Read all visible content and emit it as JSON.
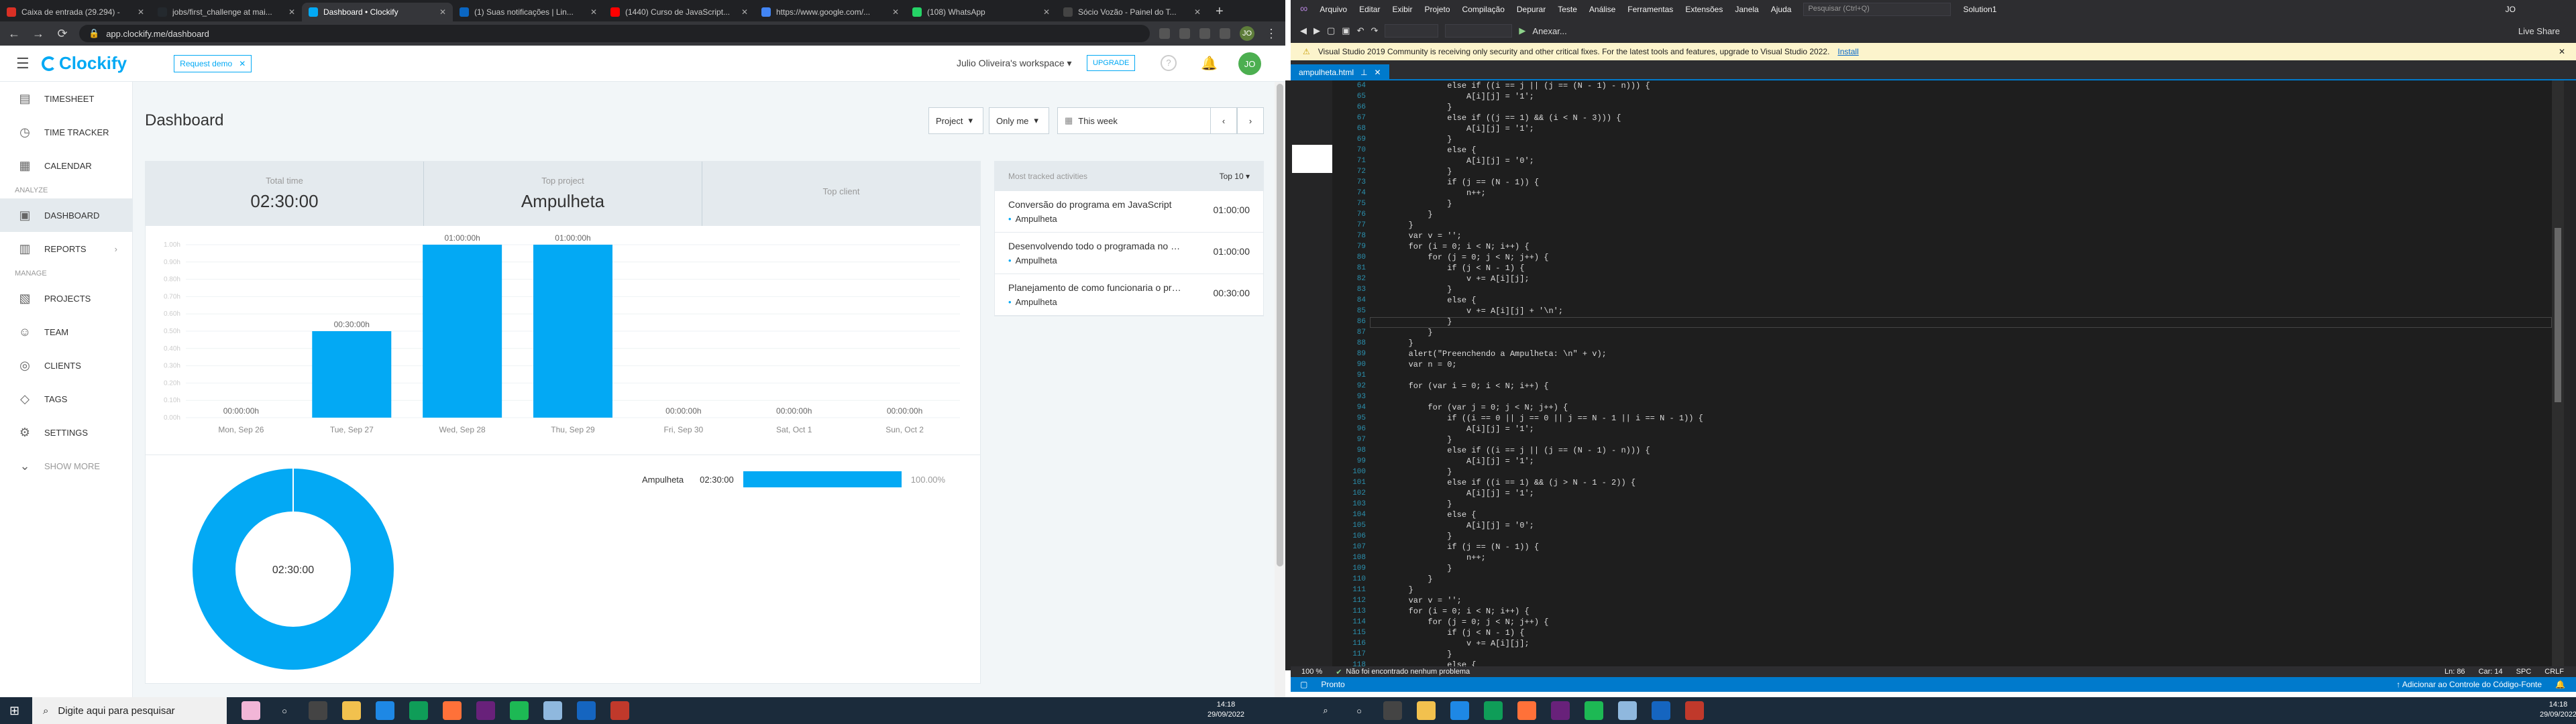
{
  "browser": {
    "tabs": [
      {
        "title": "Caixa de entrada (29.294) -",
        "color": "#d93025"
      },
      {
        "title": "jobs/first_challenge at mai...",
        "color": "#24292e"
      },
      {
        "title": "Dashboard • Clockify",
        "color": "#03a9f4",
        "active": true
      },
      {
        "title": "(1) Suas notificações | Lin...",
        "color": "#0a66c2"
      },
      {
        "title": "(1440) Curso de JavaScript...",
        "color": "#ff0000"
      },
      {
        "title": "https://www.google.com/...",
        "color": "#4285f4"
      },
      {
        "title": "(108) WhatsApp",
        "color": "#25d366"
      },
      {
        "title": "Sócio Vozão - Painel do T...",
        "color": "#444444"
      }
    ],
    "new_tab": "+",
    "url": "app.clockify.me/dashboard",
    "profile": "JO"
  },
  "clockify": {
    "logo": "Clockify",
    "request_demo": "Request demo",
    "workspace": "Julio Oliveira's workspace",
    "upgrade": "UPGRADE",
    "user_initials": "JO",
    "sidebar": {
      "timesheet": "TIMESHEET",
      "time_tracker": "TIME TRACKER",
      "calendar": "CALENDAR",
      "section_analyze": "ANALYZE",
      "dashboard": "DASHBOARD",
      "reports": "REPORTS",
      "section_manage": "MANAGE",
      "projects": "PROJECTS",
      "team": "TEAM",
      "clients": "CLIENTS",
      "tags": "TAGS",
      "settings": "SETTINGS",
      "show_more": "SHOW MORE"
    },
    "title": "Dashboard",
    "filters": {
      "group": "Project",
      "scope": "Only me",
      "range": "This week"
    },
    "summary": {
      "total_time_label": "Total time",
      "total_time": "02:30:00",
      "top_project_label": "Top project",
      "top_project": "Ampulheta",
      "top_client_label": "Top client",
      "top_client": ""
    },
    "activities": {
      "header": "Most tracked activities",
      "top": "Top 10",
      "items": [
        {
          "desc": "Conversão do programa em JavaScript",
          "project": "Ampulheta",
          "time": "01:00:00"
        },
        {
          "desc": "Desenvolvendo todo o programada no Node",
          "project": "Ampulheta",
          "time": "01:00:00"
        },
        {
          "desc": "Planejamento de como funcionaria o programa",
          "project": "Ampulheta",
          "time": "00:30:00"
        }
      ]
    },
    "pie": {
      "center": "02:30:00",
      "legend_project": "Ampulheta",
      "legend_time": "02:30:00",
      "legend_percent": "100.00%",
      "fraction": 1.0
    },
    "colors": {
      "accent": "#03a9f4"
    }
  },
  "chart_data": {
    "type": "bar",
    "categories": [
      "Mon, Sep 26",
      "Tue, Sep 27",
      "Wed, Sep 28",
      "Thu, Sep 29",
      "Fri, Sep 30",
      "Sat, Oct 1",
      "Sun, Oct 2"
    ],
    "values": [
      0,
      0.5,
      1.0,
      1.0,
      0,
      0,
      0
    ],
    "data_labels": [
      "00:00:00h",
      "00:30:00h",
      "01:00:00h",
      "01:00:00h",
      "00:00:00h",
      "00:00:00h",
      "00:00:00h"
    ],
    "y_ticks": [
      "0.00h",
      "0.10h",
      "0.20h",
      "0.30h",
      "0.40h",
      "0.50h",
      "0.60h",
      "0.70h",
      "0.80h",
      "0.90h",
      "1.00h"
    ],
    "ylim": [
      0,
      1.0
    ],
    "color": "#03a9f4"
  },
  "vs": {
    "menu": [
      "Arquivo",
      "Editar",
      "Exibir",
      "Projeto",
      "Compilação",
      "Depurar",
      "Teste",
      "Análise",
      "Ferramentas",
      "Extensões",
      "Janela",
      "Ajuda"
    ],
    "search_placeholder": "Pesquisar (Ctrl+Q)",
    "solution": "Solution1",
    "user": "JO",
    "run": "Anexar...",
    "live_share": "Live Share",
    "info_text": "Visual Studio 2019 Community is receiving only security and other critical fixes. For the latest tools and features, upgrade to Visual Studio 2022.",
    "info_link": "Install",
    "file_tab": "ampulheta.html",
    "zoom": "100 %",
    "issues": "Não foi encontrado nenhum problema",
    "cursor": "Ln: 86",
    "col": "Car: 14",
    "spc": "SPC",
    "crlf": "CRLF",
    "status_ready": "Pronto",
    "status_git": "Adicionar ao Controle do Código-Fonte",
    "code_top": [
      {
        "n": "64",
        "t": "                else if ((i == j || (j == (N - 1) - n))) {"
      },
      {
        "n": "65",
        "t": "                    A[i][j] = '1';"
      },
      {
        "n": "66",
        "t": "                }"
      },
      {
        "n": "67",
        "t": "                else if ((j == 1) && (i < N - 3))) {"
      },
      {
        "n": "68",
        "t": "                    A[i][j] = '1';"
      },
      {
        "n": "69",
        "t": "                }"
      },
      {
        "n": "70",
        "t": "                else {"
      },
      {
        "n": "71",
        "t": "                    A[i][j] = '0';"
      },
      {
        "n": "72",
        "t": "                }"
      },
      {
        "n": "73",
        "t": "                if (j == (N - 1)) {"
      },
      {
        "n": "74",
        "t": "                    n++;"
      },
      {
        "n": "75",
        "t": "                }"
      },
      {
        "n": "76",
        "t": "            }"
      },
      {
        "n": "77",
        "t": "        }"
      },
      {
        "n": "78",
        "t": "        var v = '';"
      },
      {
        "n": "79",
        "t": "        for (i = 0; i < N; i++) {"
      },
      {
        "n": "80",
        "t": "            for (j = 0; j < N; j++) {"
      },
      {
        "n": "81",
        "t": "                if (j < N - 1) {"
      },
      {
        "n": "82",
        "t": "                    v += A[i][j];"
      },
      {
        "n": "83",
        "t": "                }"
      },
      {
        "n": "84",
        "t": "                else {"
      },
      {
        "n": "85",
        "t": "                    v += A[i][j] + '\\n';"
      },
      {
        "n": "86",
        "t": "                }"
      },
      {
        "n": "87",
        "t": "            }"
      },
      {
        "n": "88",
        "t": "        }"
      },
      {
        "n": "89",
        "t": "        alert(\"Preenchendo a Ampulheta: \\n\" + v);"
      },
      {
        "n": "90",
        "t": "        var n = 0;"
      },
      {
        "n": "91",
        "t": ""
      },
      {
        "n": "92",
        "t": "        for (var i = 0; i < N; i++) {"
      },
      {
        "n": "93",
        "t": ""
      },
      {
        "n": "94",
        "t": "            for (var j = 0; j < N; j++) {"
      },
      {
        "n": "95",
        "t": "                if ((i == 0 || j == 0 || j == N - 1 || i == N - 1)) {"
      },
      {
        "n": "96",
        "t": "                    A[i][j] = '1';"
      },
      {
        "n": "97",
        "t": "                }"
      },
      {
        "n": "98",
        "t": "                else if ((i == j || (j == (N - 1) - n))) {"
      },
      {
        "n": "99",
        "t": "                    A[i][j] = '1';"
      },
      {
        "n": "100",
        "t": "                }"
      },
      {
        "n": "101",
        "t": "                else if ((i == 1) && (j > N - 1 - 2)) {"
      },
      {
        "n": "102",
        "t": "                    A[i][j] = '1';"
      },
      {
        "n": "103",
        "t": "                }"
      },
      {
        "n": "104",
        "t": "                else {"
      },
      {
        "n": "105",
        "t": "                    A[i][j] = '0';"
      },
      {
        "n": "106",
        "t": "                }"
      },
      {
        "n": "107",
        "t": "                if (j == (N - 1)) {"
      },
      {
        "n": "108",
        "t": "                    n++;"
      },
      {
        "n": "109",
        "t": "                }"
      },
      {
        "n": "110",
        "t": "            }"
      },
      {
        "n": "111",
        "t": "        }"
      },
      {
        "n": "112",
        "t": "        var v = '';"
      },
      {
        "n": "113",
        "t": "        for (i = 0; i < N; i++) {"
      },
      {
        "n": "114",
        "t": "            for (j = 0; j < N; j++) {"
      },
      {
        "n": "115",
        "t": "                if (j < N - 1) {"
      },
      {
        "n": "116",
        "t": "                    v += A[i][j];"
      },
      {
        "n": "117",
        "t": "                }"
      },
      {
        "n": "118",
        "t": "                else {"
      }
    ]
  },
  "taskbar": {
    "search_placeholder": "Digite aqui para pesquisar",
    "time_left": "14:18",
    "date_left": "29/09/2022",
    "time_right": "14:18",
    "date_right": "29/09/2022"
  }
}
